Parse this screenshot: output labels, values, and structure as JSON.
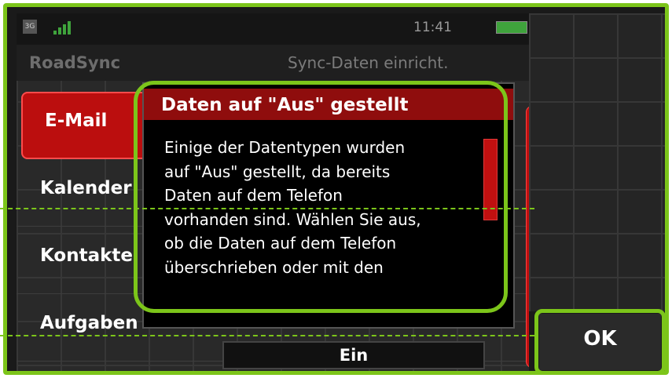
{
  "status": {
    "time": "11:41",
    "net_label": "3G"
  },
  "header": {
    "app_name": "RoadSync",
    "screen_title": "Sync-Daten einricht."
  },
  "list": {
    "items": [
      {
        "label": "E-Mail",
        "selected": true
      },
      {
        "label": "Kalender"
      },
      {
        "label": "Kontakte"
      },
      {
        "label": "Aufgaben"
      }
    ],
    "toggle_value": "Ein"
  },
  "dialog": {
    "title": "Daten auf \"Aus\" gestellt",
    "lines": [
      "Einige der Datentypen wurden",
      "auf \"Aus\" gestellt, da bereits",
      "Daten auf dem Telefon",
      "vorhanden sind. Wählen Sie aus,",
      "ob die Daten auf dem Telefon",
      "überschrieben oder mit den"
    ]
  },
  "softkeys": {
    "ok_label": "OK"
  },
  "colors": {
    "accent": "#7cc51a",
    "selection": "#bb0e0e",
    "dialog_title_bg": "#8f0d0d"
  },
  "icons": [
    "network-icon",
    "signal-icon",
    "battery-icon"
  ]
}
